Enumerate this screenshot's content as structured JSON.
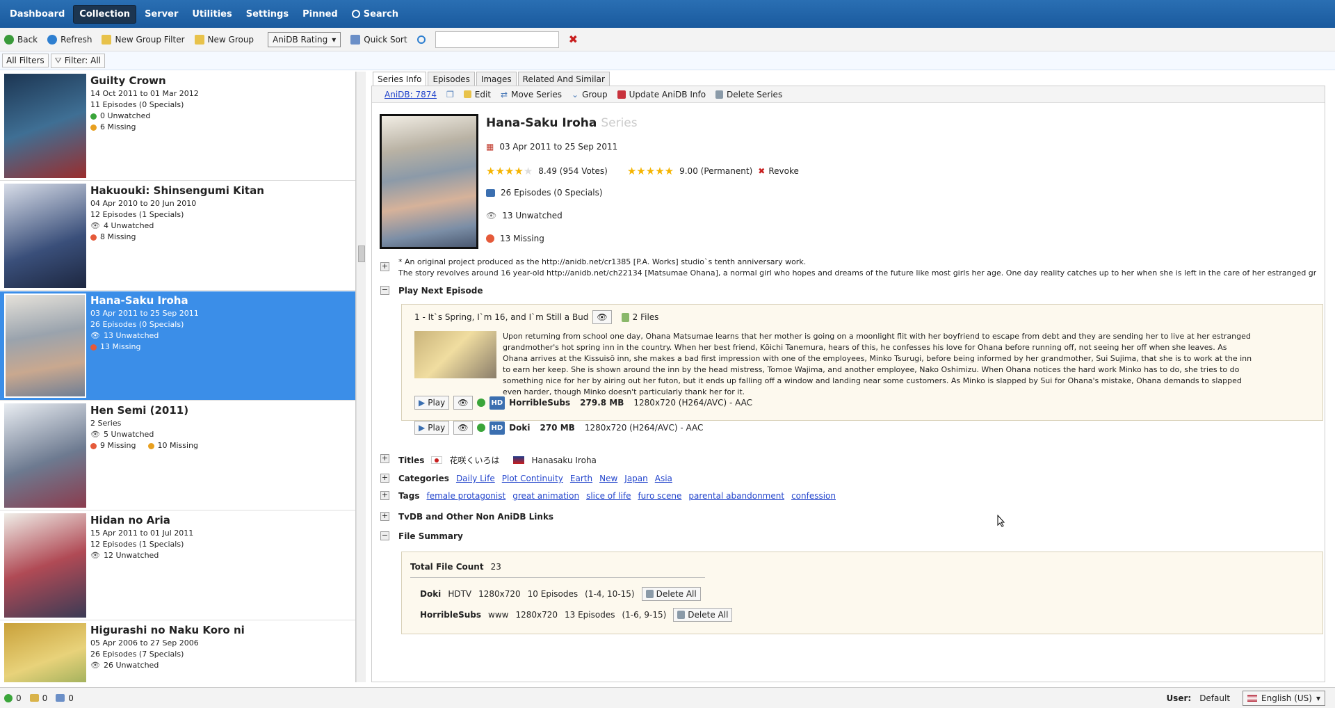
{
  "nav": {
    "dashboard": "Dashboard",
    "collection": "Collection",
    "server": "Server",
    "utilities": "Utilities",
    "settings": "Settings",
    "pinned": "Pinned",
    "search": "Search"
  },
  "toolbar": {
    "back": "Back",
    "refresh": "Refresh",
    "new_group_filter": "New Group Filter",
    "new_group": "New Group",
    "sort_select": "AniDB Rating",
    "quick_sort": "Quick Sort",
    "search_value": ""
  },
  "filters": {
    "all_filters": "All Filters",
    "filter": "Filter: All"
  },
  "series_list": [
    {
      "title": "Guilty Crown",
      "dates": "14 Oct 2011  to  01 Mar 2012",
      "episodes": "11 Episodes (0 Specials)",
      "unwatched": "0  Unwatched",
      "missing": "6  Missing",
      "color": "#2b4a6b"
    },
    {
      "title": "Hakuouki: Shinsengumi Kitan",
      "dates": "04 Apr 2010  to  20 Jun 2010",
      "episodes": "12 Episodes (1 Specials)",
      "unwatched": "4  Unwatched",
      "missing": "8  Missing",
      "color": "#3a4f7a"
    },
    {
      "title": "Hana-Saku Iroha",
      "dates": "03 Apr 2011  to  25 Sep 2011",
      "episodes": "26 Episodes (0 Specials)",
      "unwatched": "13  Unwatched",
      "missing": "13  Missing",
      "color": "#8c9aa8"
    },
    {
      "title": "Hen Semi (2011)",
      "dates": "2 Series",
      "episodes": "5  Unwatched",
      "unwatched": "9  Missing",
      "missing": "10  Missing",
      "color": "#6d7a90"
    },
    {
      "title": "Hidan no Aria",
      "dates": "15 Apr 2011  to  01 Jul 2011",
      "episodes": "12 Episodes (1 Specials)",
      "unwatched": "12  Unwatched",
      "missing": "",
      "color": "#b04a55"
    },
    {
      "title": "Higurashi no Naku Koro ni",
      "dates": "05 Apr 2006  to  27 Sep 2006",
      "episodes": "26 Episodes (7 Specials)",
      "unwatched": "26  Unwatched",
      "missing": "",
      "color": "#c9a13a"
    }
  ],
  "tabs": [
    "Series Info",
    "Episodes",
    "Images",
    "Related And Similar"
  ],
  "actions": {
    "anidb_link": "AniDB: 7874",
    "edit": "Edit",
    "move": "Move Series",
    "group": "Group",
    "update": "Update AniDB Info",
    "delete": "Delete Series"
  },
  "detail": {
    "title": "Hana-Saku Iroha",
    "title_sub": "Series",
    "dates": "03 Apr 2011  to  25 Sep 2011",
    "rating": "8.49 (954 Votes)",
    "user_rating": "9.00 (Permanent)",
    "revoke": "Revoke",
    "episodes": "26 Episodes (0 Specials)",
    "unwatched": "13  Unwatched",
    "missing": "13  Missing",
    "desc1": "* An original project produced as the http://anidb.net/cr1385 [P.A. Works] studio`s tenth anniversary work.",
    "desc2": "The story revolves around 16 year-old http://anidb.net/ch22134 [Matsumae Ohana], a normal girl who hopes and dreams of the future like most girls her age. One day reality catches up to her when she is left in the care of her estranged grandmo ..."
  },
  "play_next": {
    "header": "Play Next Episode",
    "ep_title": "1 - It`s Spring, I`m 16, and I`m Still a Bud",
    "files": "2 Files",
    "summary": "Upon returning from school one day, Ohana Matsumae learns that her mother is going on a moonlight flit with her boyfriend to escape from debt and they are sending her to live at her estranged grandmother's hot spring inn in the country. When her best friend, Kōichi Tanemura, hears of this, he confesses his love for Ohana before running off, not seeing her off when she leaves. As Ohana arrives at the Kissuisō inn, she makes a bad first impression with one of the employees, Minko Tsurugi, before being informed by her grandmother, Sui Sujima, that she is to work at the inn to earn her keep. She is shown around the inn by the head mistress, Tomoe Wajima, and another employee, Nako Oshimizu. When Ohana notices the hard work Minko has to do, she tries to do something nice for her by airing out her futon, but it ends up falling off a window and landing near some customers. As Minko is slapped by Sui for Ohana's mistake, Ohana demands to slapped even harder, though Minko doesn't particularly thank her for it.",
    "play": "Play",
    "hd": "HD",
    "rows": [
      {
        "group": "HorribleSubs",
        "size": "279.8 MB",
        "spec": "1280x720 (H264/AVC) - AAC"
      },
      {
        "group": "Doki",
        "size": "270 MB",
        "spec": "1280x720 (H264/AVC) - AAC"
      }
    ]
  },
  "titles": {
    "label": "Titles",
    "jp": "花咲くいろは",
    "en": "Hanasaku Iroha"
  },
  "categories": {
    "label": "Categories",
    "items": [
      "Daily Life",
      "Plot Continuity",
      "Earth",
      "New",
      "Japan",
      "Asia"
    ]
  },
  "tags": {
    "label": "Tags",
    "items": [
      "female protagonist",
      "great animation",
      "slice of life",
      "furo scene",
      "parental abandonment",
      "confession"
    ]
  },
  "tvdb": {
    "label": "TvDB and Other Non AniDB Links"
  },
  "file_summary": {
    "label": "File Summary",
    "total_label": "Total File Count",
    "total": "23",
    "delete_all": "Delete All",
    "rows": [
      {
        "group": "Doki",
        "source": "HDTV",
        "res": "1280x720",
        "eps": "10 Episodes",
        "range": "(1-4, 10-15)"
      },
      {
        "group": "HorribleSubs",
        "source": "www",
        "res": "1280x720",
        "eps": "13 Episodes",
        "range": "(1-6, 9-15)"
      }
    ]
  },
  "status": {
    "a": "0",
    "b": "0",
    "c": "0",
    "user_label": "User:",
    "user": "Default",
    "lang": "English (US)"
  }
}
